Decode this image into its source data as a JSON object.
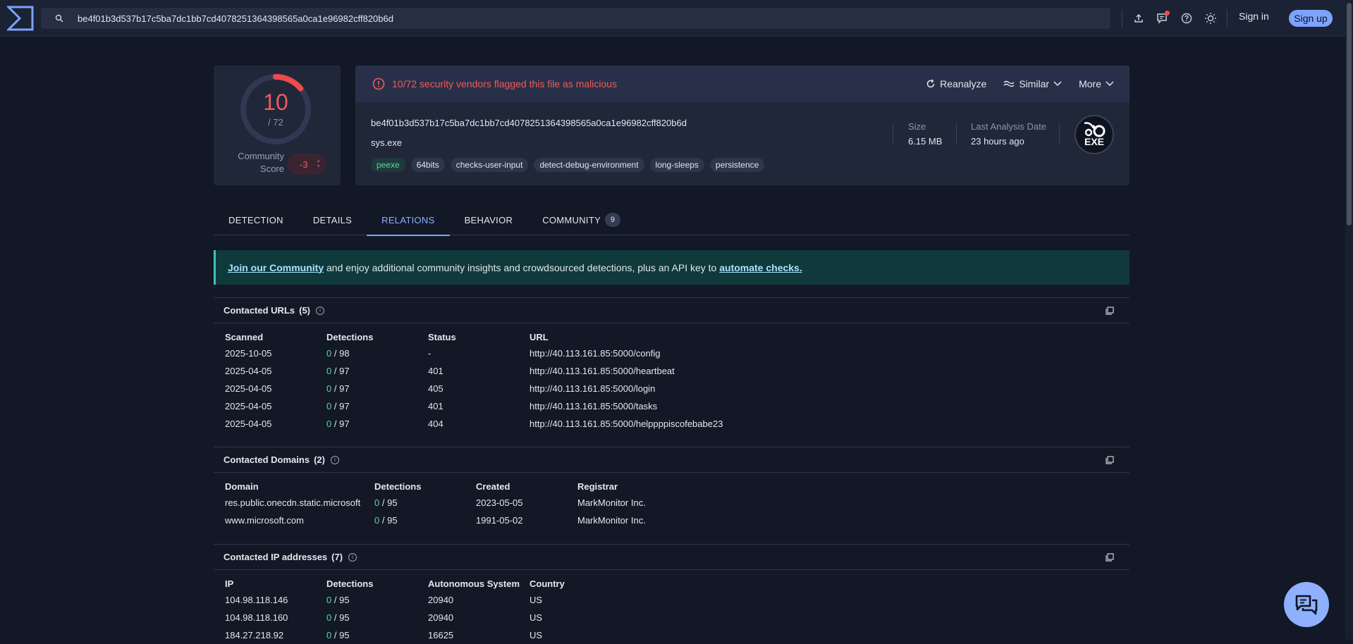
{
  "topbar": {
    "search_value": "be4f01b3d537b17c5ba7dc1bb7cd4078251364398565a0ca1e96982cff820b6d",
    "sign_in": "Sign in",
    "sign_up": "Sign up"
  },
  "score": {
    "detections": "10",
    "total": "/ 72",
    "detection_fraction": 0.139,
    "community_label": "Community Score",
    "community_value": "-3"
  },
  "file": {
    "alert": "10/72 security vendors flagged this file as malicious",
    "actions": {
      "reanalyze": "Reanalyze",
      "similar": "Similar",
      "more": "More"
    },
    "hash": "be4f01b3d537b17c5ba7dc1bb7cd4078251364398565a0ca1e96982cff820b6d",
    "name": "sys.exe",
    "tags": [
      "peexe",
      "64bits",
      "checks-user-input",
      "detect-debug-environment",
      "long-sleeps",
      "persistence"
    ],
    "size_label": "Size",
    "size_value": "6.15 MB",
    "date_label": "Last Analysis Date",
    "date_value": "23 hours ago",
    "type_icon_text": "EXE"
  },
  "tabs": [
    {
      "label": "DETECTION"
    },
    {
      "label": "DETAILS"
    },
    {
      "label": "RELATIONS"
    },
    {
      "label": "BEHAVIOR"
    },
    {
      "label": "COMMUNITY",
      "badge": "9"
    }
  ],
  "banner": {
    "link1": "Join our Community",
    "text": " and enjoy additional community insights and crowdsourced detections, plus an API key to ",
    "link2": "automate checks."
  },
  "urls": {
    "title": "Contacted URLs",
    "count": "(5)",
    "headers": [
      "Scanned",
      "Detections",
      "Status",
      "URL"
    ],
    "rows": [
      [
        "2025-10-05",
        "0",
        "/ 98",
        "-",
        "http://40.113.161.85:5000/config"
      ],
      [
        "2025-04-05",
        "0",
        "/ 97",
        "401",
        "http://40.113.161.85:5000/heartbeat"
      ],
      [
        "2025-04-05",
        "0",
        "/ 97",
        "405",
        "http://40.113.161.85:5000/login"
      ],
      [
        "2025-04-05",
        "0",
        "/ 97",
        "401",
        "http://40.113.161.85:5000/tasks"
      ],
      [
        "2025-04-05",
        "0",
        "/ 97",
        "404",
        "http://40.113.161.85:5000/helppppiscofebabe23"
      ]
    ]
  },
  "domains": {
    "title": "Contacted Domains",
    "count": "(2)",
    "headers": [
      "Domain",
      "Detections",
      "Created",
      "Registrar"
    ],
    "rows": [
      [
        "res.public.onecdn.static.microsoft",
        "0",
        "/ 95",
        "2023-05-05",
        "MarkMonitor Inc."
      ],
      [
        "www.microsoft.com",
        "0",
        "/ 95",
        "1991-05-02",
        "MarkMonitor Inc."
      ]
    ]
  },
  "ips": {
    "title": "Contacted IP addresses",
    "count": "(7)",
    "headers": [
      "IP",
      "Detections",
      "Autonomous System",
      "Country"
    ],
    "rows": [
      [
        "104.98.118.146",
        "0",
        "/ 95",
        "20940",
        "US"
      ],
      [
        "104.98.118.160",
        "0",
        "/ 95",
        "20940",
        "US"
      ],
      [
        "184.27.218.92",
        "0",
        "/ 95",
        "16625",
        "US"
      ]
    ]
  }
}
